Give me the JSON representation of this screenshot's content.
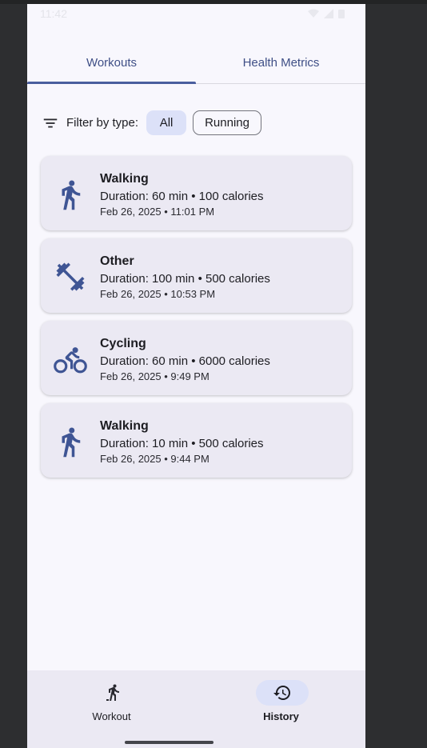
{
  "status_bar": {
    "time": "11:42"
  },
  "tabs": [
    {
      "label": "Workouts",
      "selected": true
    },
    {
      "label": "Health Metrics",
      "selected": false
    }
  ],
  "filter": {
    "label": "Filter by type:",
    "chips": [
      {
        "label": "All",
        "selected": true
      },
      {
        "label": "Running",
        "selected": false
      }
    ]
  },
  "workouts": [
    {
      "icon": "walking-icon",
      "title": "Walking",
      "detail": "Duration: 60 min • 100 calories",
      "date": "Feb 26, 2025 • 11:01 PM"
    },
    {
      "icon": "dumbbell-icon",
      "title": "Other",
      "detail": "Duration: 100 min • 500 calories",
      "date": "Feb 26, 2025 • 10:53 PM"
    },
    {
      "icon": "cycling-icon",
      "title": "Cycling",
      "detail": "Duration: 60 min • 6000 calories",
      "date": "Feb 26, 2025 • 9:49 PM"
    },
    {
      "icon": "walking-icon",
      "title": "Walking",
      "detail": "Duration: 10 min • 500 calories",
      "date": "Feb 26, 2025 • 9:44 PM"
    }
  ],
  "bottom_nav": [
    {
      "label": "Workout",
      "icon": "running-icon",
      "selected": false
    },
    {
      "label": "History",
      "icon": "history-icon",
      "selected": true
    }
  ],
  "colors": {
    "accent": "#4a5e9e",
    "chip_selected": "#dce1f8",
    "card_bg": "#ebe9f3",
    "background": "#f8f7fd"
  }
}
